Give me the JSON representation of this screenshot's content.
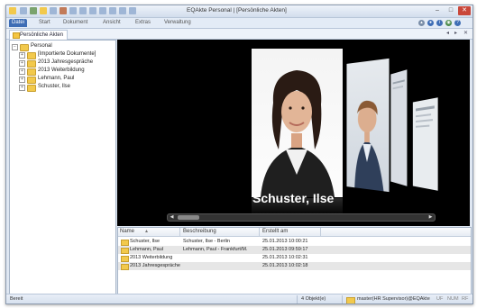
{
  "window": {
    "title": "EQAkte Personal | [Persönliche Akten]",
    "controls": [
      "–",
      "□",
      "✕"
    ]
  },
  "ribbon": {
    "tabs": [
      "Datei",
      "Start",
      "Dokument",
      "Ansicht",
      "Extras",
      "Verwaltung"
    ],
    "active_tab": "Datei"
  },
  "document_tab": {
    "label": "Persönliche Akten",
    "nav": [
      "◂",
      "▸",
      "✕"
    ]
  },
  "tree": {
    "root": "Personal",
    "children": [
      "[Importierte Dokumente]",
      "2013 Jahresgespräche",
      "2013 Weiterbildung",
      "Lehmann, Paul",
      "Schuster, Ilse"
    ]
  },
  "preview": {
    "current_name": "Schuster, Ilse"
  },
  "grid": {
    "columns": [
      "Name",
      "Beschreibung",
      "Erstellt am"
    ],
    "rows": [
      {
        "name": "Schuster, Ilse",
        "description": "Schuster, Ilse - Berlin",
        "created": "25.01.2013 10:00:21"
      },
      {
        "name": "Lehmann, Paul",
        "description": "Lehmann, Paul - Frankfurt/M.",
        "created": "25.01.2013 09:59:17"
      },
      {
        "name": "2013 Weiterbildung",
        "description": "",
        "created": "25.01.2013 10:02:31"
      },
      {
        "name": "2013 Jahresgespräche",
        "description": "",
        "created": "25.01.2013 10:02:18"
      }
    ]
  },
  "status": {
    "left": "Bereit",
    "count": "4 Objekt(e)",
    "user": "master(HR Supervisor)@EQAkte",
    "ind1": "UF",
    "ind2": "NUM",
    "ind3": "RF"
  },
  "colors": {
    "accent": "#3e6db5",
    "folder": "#f2c94c"
  }
}
